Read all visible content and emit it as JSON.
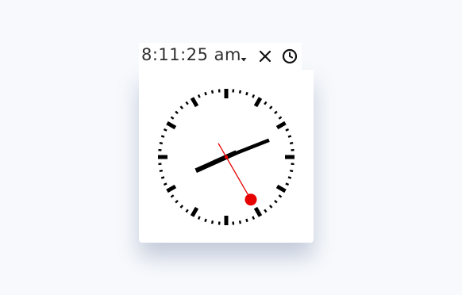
{
  "clock": {
    "time_display": "8:11:25 am",
    "hours": 8,
    "minutes": 11,
    "seconds": 25,
    "style": "swiss-railway"
  },
  "icons": {
    "dropdown": "caret-down-icon",
    "close": "close-icon",
    "alarm": "clock-icon"
  },
  "colors": {
    "background": "#f7f9fc",
    "card": "#ffffff",
    "text": "#2f2f2f",
    "ticks": "#000000",
    "hands": "#000000",
    "second_hand": "#e60000"
  }
}
